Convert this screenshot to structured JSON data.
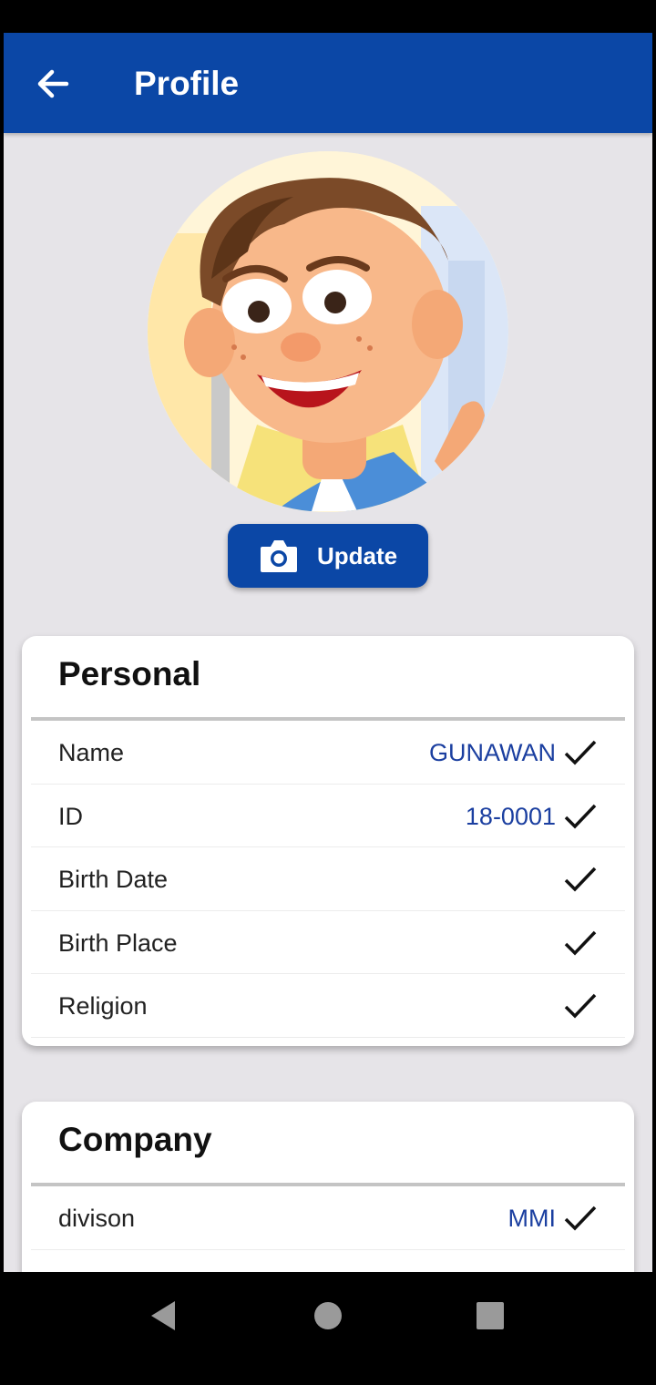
{
  "app_bar": {
    "title": "Profile",
    "back_icon": "arrow-left-icon"
  },
  "profile": {
    "avatar_icon": "cartoon-boy-avatar",
    "update_label": "Update",
    "update_icon": "camera-icon"
  },
  "personal": {
    "title": "Personal",
    "rows": [
      {
        "label": "Name",
        "value": "GUNAWAN"
      },
      {
        "label": "ID",
        "value": "18-0001"
      },
      {
        "label": "Birth Date",
        "value": ""
      },
      {
        "label": "Birth Place",
        "value": ""
      },
      {
        "label": "Religion",
        "value": ""
      }
    ]
  },
  "company": {
    "title": "Company",
    "rows": [
      {
        "label": "divison",
        "value": "MMI"
      }
    ]
  },
  "colors": {
    "primary": "#0b47a6",
    "value_text": "#1b3fa0",
    "background": "#e6e4e8"
  }
}
